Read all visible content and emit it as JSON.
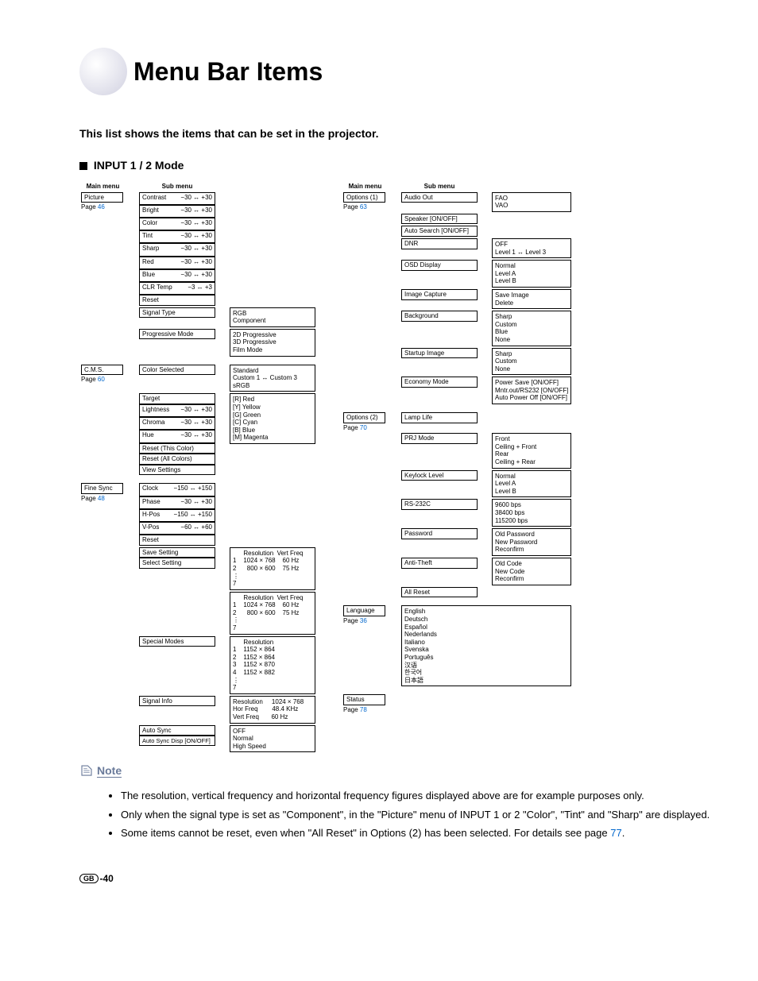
{
  "title": "Menu Bar Items",
  "subtitle": "This list shows the items that can be set in the projector.",
  "mode_header": "INPUT 1 / 2 Mode",
  "col_heads": {
    "main": "Main menu",
    "sub": "Sub menu"
  },
  "left": {
    "picture": {
      "name": "Picture",
      "page_label": "Page ",
      "page": "46",
      "subs": [
        {
          "label": "Contrast",
          "range": "−30 ↔ +30"
        },
        {
          "label": "Bright",
          "range": "−30 ↔ +30"
        },
        {
          "label": "Color",
          "range": "−30 ↔ +30"
        },
        {
          "label": "Tint",
          "range": "−30 ↔ +30"
        },
        {
          "label": "Sharp",
          "range": "−30 ↔ +30"
        },
        {
          "label": "Red",
          "range": "−30 ↔ +30"
        },
        {
          "label": "Blue",
          "range": "−30 ↔ +30"
        },
        {
          "label": "CLR Temp",
          "range": "−3 ↔ +3"
        },
        {
          "label": "Reset",
          "range": ""
        }
      ],
      "signal_type": {
        "label": "Signal Type",
        "opts": "RGB\nComponent"
      },
      "progressive": {
        "label": "Progressive Mode",
        "opts": "2D Progressive\n3D Progressive\nFilm Mode"
      }
    },
    "cms": {
      "name": "C.M.S.",
      "page_label": "Page ",
      "page": "60",
      "color_selected": {
        "label": "Color Selected",
        "opts": "Standard\nCustom 1 ↔ Custom 3\nsRGB"
      },
      "target": {
        "label": "Target",
        "opts": "[R] Red\n[Y] Yellow\n[G] Green\n[C] Cyan\n[B] Blue\n[M] Magenta"
      },
      "params": [
        {
          "label": "Lightness",
          "range": "−30 ↔ +30"
        },
        {
          "label": "Chroma",
          "range": "−30 ↔ +30"
        },
        {
          "label": "Hue",
          "range": "−30 ↔ +30"
        }
      ],
      "extras": [
        "Reset (This Color)",
        "Reset (All Colors)",
        "View Settings"
      ]
    },
    "fine_sync": {
      "name": "Fine Sync",
      "page_label": "Page ",
      "page": "48",
      "params": [
        {
          "label": "Clock",
          "range": "−150 ↔ +150"
        },
        {
          "label": "Phase",
          "range": "−30 ↔ +30"
        },
        {
          "label": "H-Pos",
          "range": "−150 ↔ +150"
        },
        {
          "label": "V-Pos",
          "range": "−60 ↔ +60"
        },
        {
          "label": "Reset",
          "range": ""
        }
      ],
      "save_setting": {
        "label": "Save Setting",
        "table": "      Resolution  Vert Freq\n1    1024 × 768    60 Hz\n2      800 × 600    75 Hz\n⋮\n7"
      },
      "select_setting": {
        "label": "Select Setting",
        "table": "      Resolution  Vert Freq\n1    1024 × 768    60 Hz\n2      800 × 600    75 Hz\n⋮\n7"
      },
      "special_modes": {
        "label": "Special Modes",
        "table": "      Resolution\n1    1152 × 864\n2    1152 × 864\n3    1152 × 870\n4    1152 × 882\n⋮\n7"
      },
      "signal_info": {
        "label": "Signal Info",
        "table": "Resolution     1024 × 768\nHor Freq        48.4 KHz\nVert Freq       60 Hz"
      },
      "auto_sync": {
        "label": "Auto Sync",
        "opts": "OFF\nNormal\nHigh Speed"
      },
      "auto_sync_disp": "Auto Sync Disp [ON/OFF]"
    }
  },
  "right": {
    "options1": {
      "name": "Options (1)",
      "page_label": "Page ",
      "page": "63",
      "subs": [
        {
          "label": "Audio Out",
          "opts": "FAO\nVAO"
        },
        {
          "label": "Speaker [ON/OFF]",
          "opts": ""
        },
        {
          "label": "Auto Search [ON/OFF]",
          "opts": ""
        },
        {
          "label": "DNR",
          "opts": "OFF\nLevel 1 ↔ Level 3"
        },
        {
          "label": "OSD Display",
          "opts": "Normal\nLevel A\nLevel B"
        },
        {
          "label": "Image Capture",
          "opts": "Save Image\nDelete"
        },
        {
          "label": "Background",
          "opts": "Sharp\nCustom\nBlue\nNone"
        },
        {
          "label": "Startup Image",
          "opts": "Sharp\nCustom\nNone"
        },
        {
          "label": "Economy Mode",
          "opts": "Power Save [ON/OFF]\nMntr.out/RS232 [ON/OFF]\nAuto Power Off [ON/OFF]"
        }
      ]
    },
    "options2": {
      "name": "Options (2)",
      "page_label": "Page ",
      "page": "70",
      "subs": [
        {
          "label": "Lamp Life",
          "opts": ""
        },
        {
          "label": "PRJ Mode",
          "opts": "Front\nCeiling + Front\nRear\nCeiling + Rear"
        },
        {
          "label": "Keylock Level",
          "opts": "Normal\nLevel A\nLevel B"
        },
        {
          "label": "RS-232C",
          "opts": "9600 bps\n38400 bps\n115200 bps"
        },
        {
          "label": "Password",
          "opts": "Old Password\nNew Password\nReconfirm"
        },
        {
          "label": "Anti-Theft",
          "opts": "Old Code\nNew Code\nReconfirm"
        },
        {
          "label": "All Reset",
          "opts": ""
        }
      ]
    },
    "language": {
      "name": "Language",
      "page_label": "Page ",
      "page": "36",
      "opts": "English\nDeutsch\nEspañol\nNederlands\nItaliano\nSvenska\nPortuguês\n汉语\n한국어\n日本語"
    },
    "status": {
      "name": "Status",
      "page_label": "Page ",
      "page": "78"
    }
  },
  "note_label": "Note",
  "notes": [
    "The resolution, vertical frequency and horizontal frequency figures displayed above are for example purposes only.",
    "Only when the signal type is set as \"Component\", in the \"Picture\" menu of INPUT 1 or 2 \"Color\", \"Tint\" and \"Sharp\" are displayed.",
    "Some items cannot be reset, even when \"All Reset\" in Options (2) has been selected. For details see page "
  ],
  "note3_page": "77",
  "footer": {
    "gb": "GB",
    "page": "-40"
  }
}
